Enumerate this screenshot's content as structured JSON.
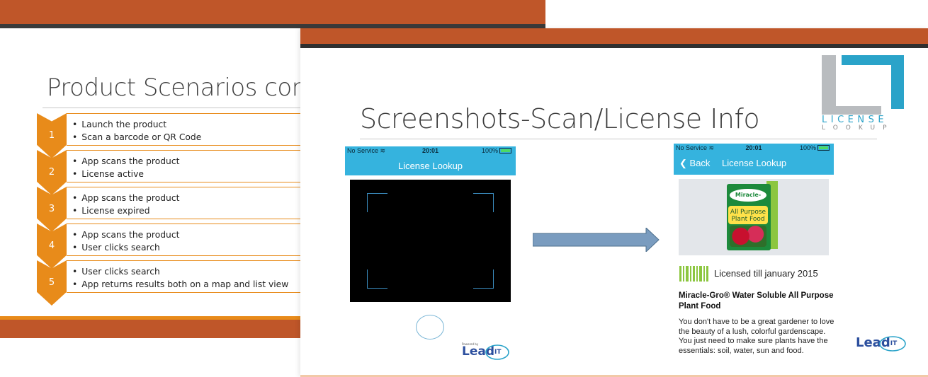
{
  "back_slide": {
    "title": "Product Scenarios cons",
    "steps": [
      {
        "number": "1",
        "bullets": [
          "Launch the product",
          "Scan a barcode or QR Code"
        ]
      },
      {
        "number": "2",
        "bullets": [
          "App scans the product",
          "License active"
        ]
      },
      {
        "number": "3",
        "bullets": [
          "App scans the product",
          "License expired"
        ]
      },
      {
        "number": "4",
        "bullets": [
          "App scans the product",
          "User clicks search"
        ]
      },
      {
        "number": "5",
        "bullets": [
          "User clicks search",
          "App returns results both on a map and list view"
        ]
      }
    ]
  },
  "front_slide": {
    "title": "Screenshots-Scan/License Info",
    "logo": {
      "line1": "LICENSE",
      "line2": "LOOKUP"
    },
    "phone_scan": {
      "status_left": "No Service",
      "status_time": "20:01",
      "status_battery": "100%",
      "nav_title": "License Lookup"
    },
    "phone_info": {
      "status_left": "No Service",
      "status_time": "20:01",
      "status_battery": "100%",
      "back_label": "Back",
      "nav_title": "License Lookup",
      "box_logo": "Miracle-Gro",
      "box_label": "All Purpose Plant Food",
      "licensed_text": "Licensed till january 2015",
      "product_title": "Miracle-Gro® Water Soluble All Purpose Plant Food",
      "product_description": "You don't have to be a great gardener to love the beauty of a lush, colorful gardenscape. You just need to make sure plants have the essentials: soil, water, sun and food."
    },
    "branding": {
      "powered_by": "Powered by",
      "lead_it": "Lead",
      "lead_it_suffix": "IT"
    }
  },
  "colors": {
    "band_orange": "#bf5629",
    "accent_orange": "#e88b1a",
    "ios_blue": "#35b3de",
    "logo_blue": "#2aa3c9"
  }
}
